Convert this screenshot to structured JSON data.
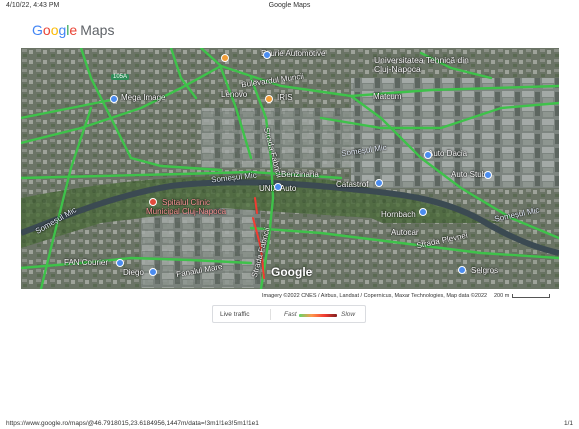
{
  "print_header": {
    "datetime": "4/10/22, 4:43 PM",
    "title": "Google Maps"
  },
  "brand": {
    "g1": "G",
    "g2": "o",
    "g3": "o",
    "g4": "g",
    "g5": "l",
    "g6": "e",
    "maps": "Maps"
  },
  "map": {
    "watermark": "Google",
    "labels": {
      "ecurie": "Ecurie Automotive",
      "univ1": "Universitatea Tehnică din",
      "univ2": "Cluj-Napoca",
      "bulevardul": "Bulevardul Muncii",
      "mega": "Mega Image",
      "iris": "IRIS",
      "lenovo": "Lenovo",
      "matcum": "Matcum",
      "somes1": "Someșul Mic",
      "somes_mid": "Someșul Mic",
      "somes_left": "Someșul Mic",
      "somes_right": "Someșul Mic",
      "auto_dacia": "Auto Dacia",
      "auto_stub": "Auto Stub",
      "unix": "UNIX Auto",
      "catastrof": "Catastrof",
      "hombach": "Hornbach",
      "spital1": "Spitalul Clinic",
      "spital2": "Municipal Cluj-Napoca",
      "fan": "FAN Courier",
      "dieg": "Diego",
      "fanalul": "Fanalul Mare",
      "strada_fabricii": "Strada Fabricii",
      "strada_plevnei": "Strada Plevnei",
      "strada_fabricii2": "Strada Fabricii",
      "autocar": "Autocar",
      "selgros": "Selgros",
      "benzina": "Benzinaria",
      "road_105a": "105A"
    }
  },
  "attribution": "Imagery ©2022 CNES / Airbus, Landsat / Copernicus, Maxar Technologies, Map data ©2022",
  "scale": {
    "label": "200 m"
  },
  "traffic_legend": {
    "live": "Live traffic",
    "fast": "Fast",
    "slow": "Slow"
  },
  "print_footer": {
    "url": "https://www.google.ro/maps/@46.7918015,23.6184956,1447m/data=!3m1!1e3!5m1!1e1",
    "page": "1/1"
  },
  "colors": {
    "traffic_fast": "#3ec24a",
    "traffic_slow": "#f23c32",
    "river": "#3b4a52"
  }
}
